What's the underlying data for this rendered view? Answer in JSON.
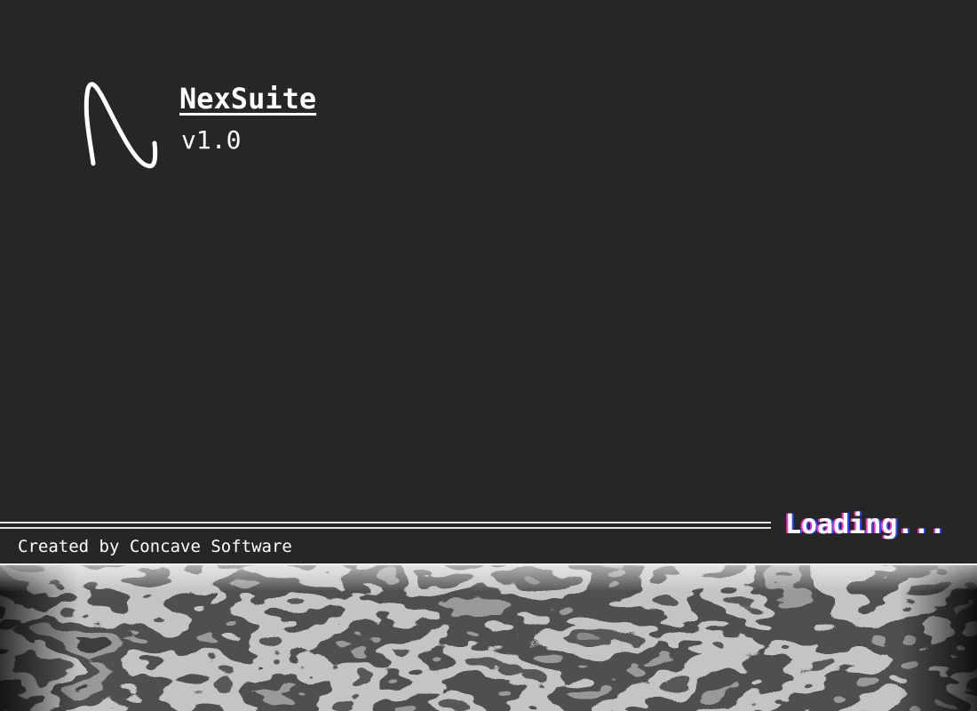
{
  "app": {
    "name": "NexSuite",
    "version": "v1.0",
    "logo_letter": "N",
    "logo_icon": "nexsuite-logo-icon"
  },
  "status": {
    "loading_text": "Loading..."
  },
  "footer": {
    "credit": "Created by Concave Software"
  },
  "colors": {
    "background": "#262626",
    "text": "#ffffff",
    "divider": "#e6e6e6",
    "glitch_magenta": "#ff2fbf",
    "glitch_blue": "#2e4cff",
    "art_base": "#0b0b0b"
  }
}
